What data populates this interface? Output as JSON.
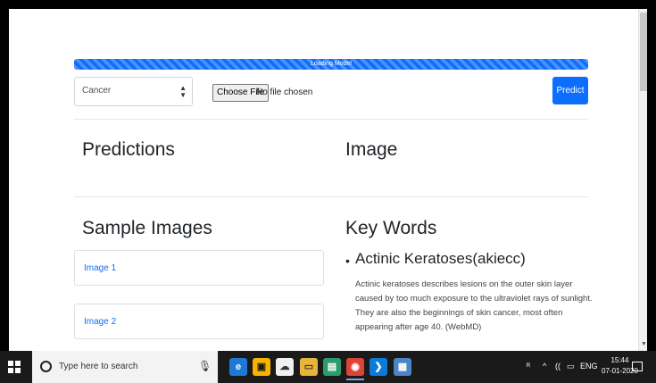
{
  "progress": {
    "label": "Loading Model",
    "percent": 100
  },
  "form": {
    "dataset_select": {
      "selected": "Cancer"
    },
    "file_input": {
      "button_label": "Choose File",
      "status": "No file chosen"
    },
    "predict_label": "Predict"
  },
  "sections": {
    "predictions_title": "Predictions",
    "image_title": "Image",
    "sample_images_title": "Sample Images",
    "key_words_title": "Key Words"
  },
  "sample_images": [
    "Image 1",
    "Image 2"
  ],
  "key_words": {
    "term": "Actinic Keratoses(akiecc)",
    "description": "Actinic keratoses describes lesions on the outer skin layer caused by too much exposure to the ultraviolet rays of sunlight. They are also the beginnings of skin cancer, most often appearing after age 40. (WebMD)"
  },
  "taskbar": {
    "search_placeholder": "Type here to search",
    "language": "ENG",
    "time": "15:44",
    "date": "07-01-2020",
    "icons": [
      "windows-icon",
      "cortana-icon",
      "microphone-icon",
      "edge-icon",
      "store-icon",
      "onedrive-icon",
      "file-explorer-icon",
      "app-icon",
      "chrome-icon",
      "vscode-icon",
      "notepad-icon"
    ]
  },
  "colors": {
    "primary": "#0d6efd",
    "taskbar": "#1a1a1a"
  }
}
